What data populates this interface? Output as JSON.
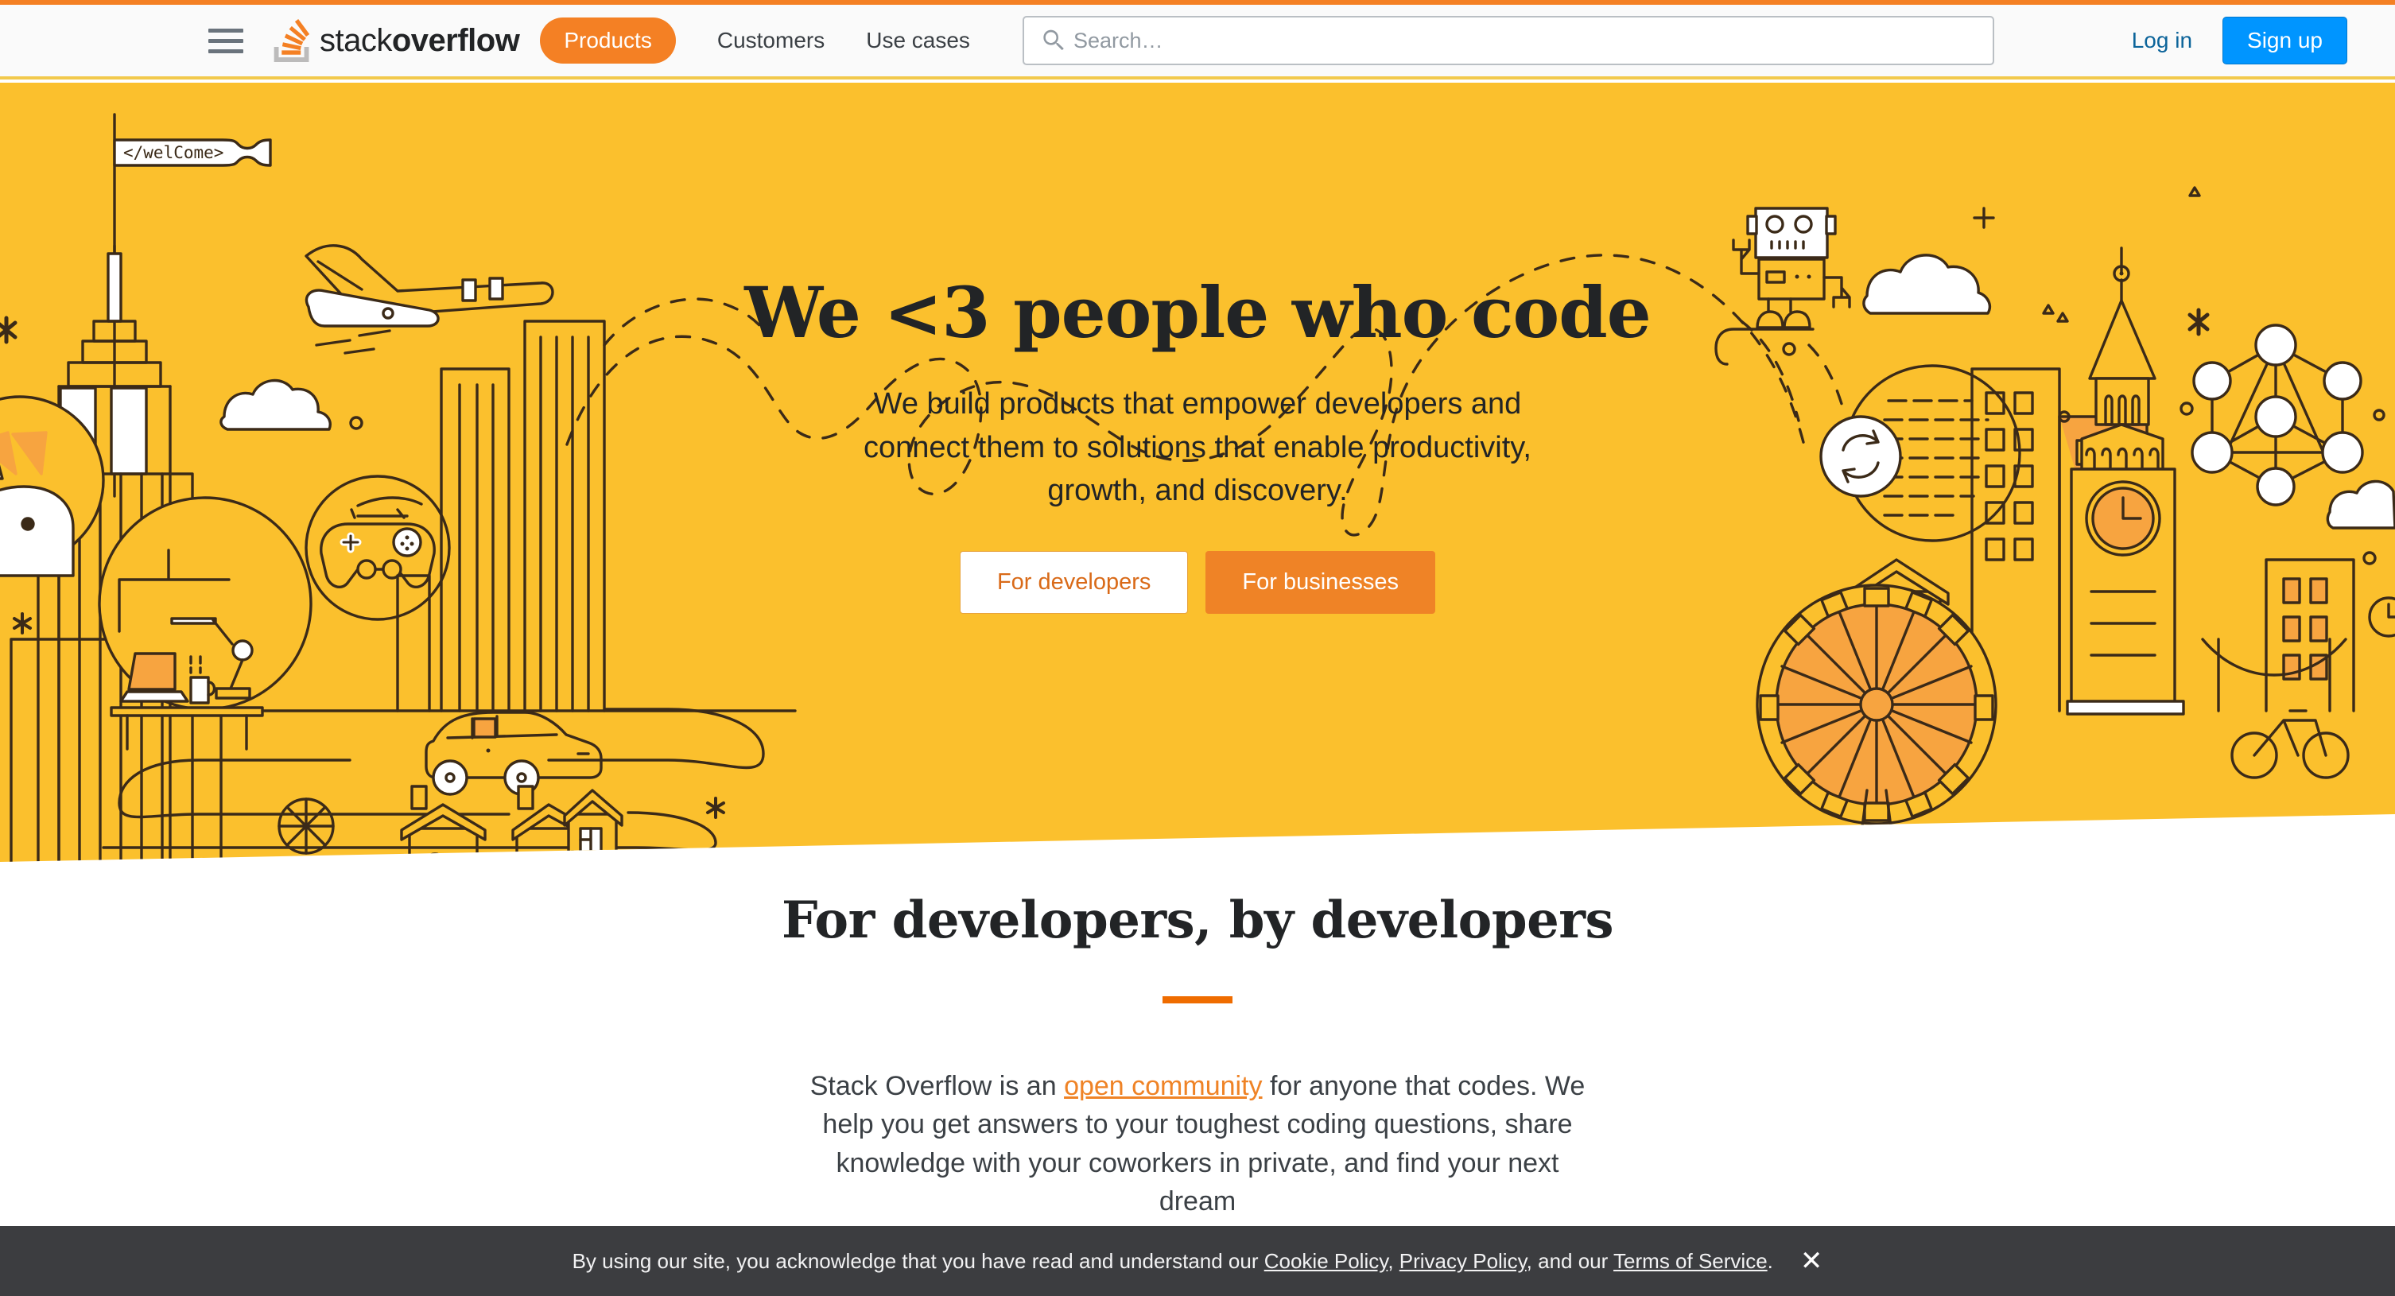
{
  "brand": {
    "logo_text_light": "stack",
    "logo_text_bold": "overflow",
    "logo_icon": "stackoverflow-logo-icon",
    "accent_orange": "#F48024",
    "hero_yellow": "#FBC02D",
    "signup_blue": "#0095FF",
    "cookie_dark": "#3C3D40"
  },
  "nav": {
    "menu_icon": "hamburger-menu-icon",
    "products_label": "Products",
    "links": [
      {
        "label": "Customers"
      },
      {
        "label": "Use cases"
      }
    ],
    "search": {
      "icon": "search-icon",
      "placeholder": "Search…",
      "value": ""
    },
    "login_label": "Log in",
    "signup_label": "Sign up"
  },
  "hero": {
    "title": "We <3 people who code",
    "subtitle": "We build products that empower developers and connect them to solutions that enable productivity, growth, and discovery.",
    "cta_primary": "For developers",
    "cta_secondary": "For businesses",
    "flag_label": "</welcome>",
    "illustration_items": [
      "empire-state-building-icon",
      "welcome-flag-icon",
      "airplane-icon",
      "cloud-icon",
      "unicorn-icon",
      "gamepad-icon",
      "desk-laptop-icon",
      "car-icon",
      "house-icon",
      "robot-icon",
      "sync-icon",
      "document-circle-icon",
      "big-ben-clock-icon",
      "network-graph-icon",
      "ferris-wheel-icon",
      "bicycle-icon",
      "skyscraper-icon",
      "asterisk-icon",
      "plus-icon",
      "triangle-icon",
      "circle-dot-icon",
      "dashed-flight-path"
    ]
  },
  "section": {
    "title": "For developers, by developers",
    "body_part1": "Stack Overflow is an ",
    "body_link": "open community",
    "body_part2": " for anyone that codes. We help you get answers to your toughest coding questions, share knowledge with your coworkers in private, and find your next dream"
  },
  "cookie": {
    "intro": "By using our site, you acknowledge that you have read and understand our ",
    "link1": "Cookie Policy",
    "sep1": ", ",
    "link2": "Privacy Policy",
    "sep2": ", and our ",
    "link3": "Terms of Service",
    "period": ".",
    "close_icon": "close-icon",
    "close_label": "✕"
  }
}
